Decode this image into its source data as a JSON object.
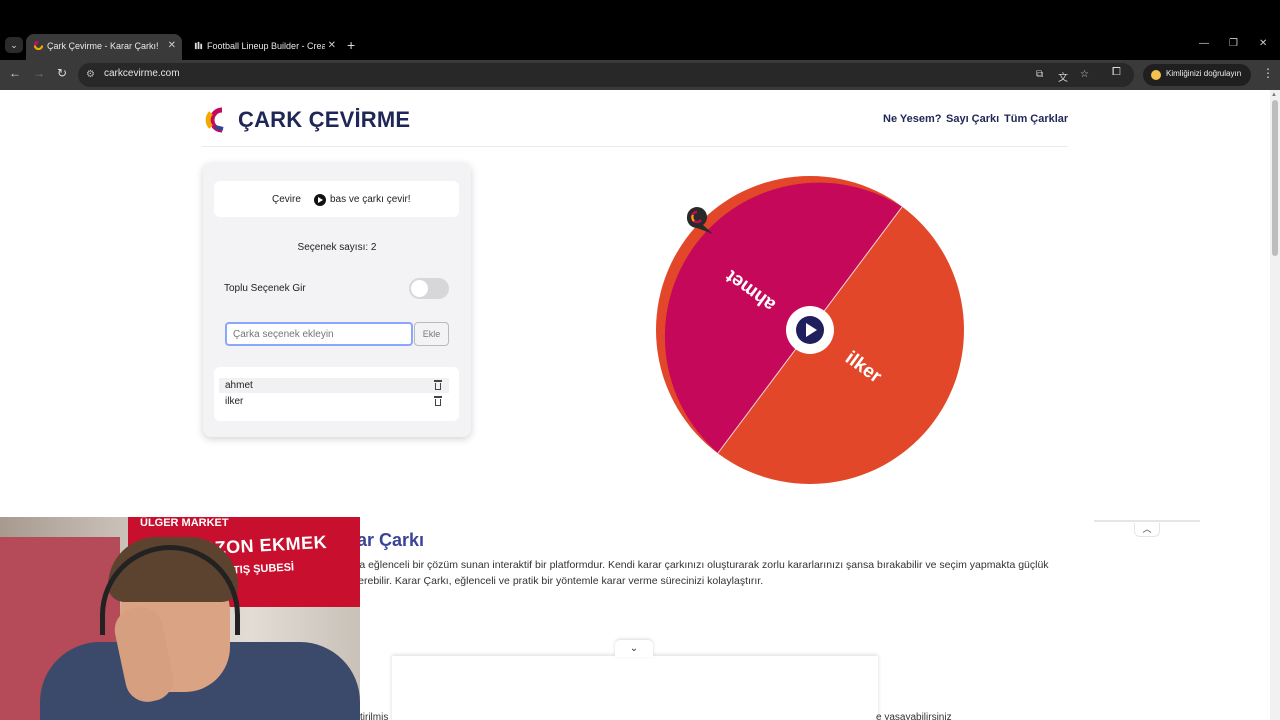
{
  "browser": {
    "tabs": [
      {
        "title": "Çark Çevirme - Karar Çarkı!",
        "active": true
      },
      {
        "title": "Football Lineup Builder - Create",
        "active": false
      }
    ],
    "url": "carkcevirme.com",
    "profile_label": "Kimliğinizi doğrulayın"
  },
  "header": {
    "brand": "ÇARK ÇEVİRME",
    "nav": [
      "Ne Yesem?",
      "Sayı Çarkı",
      "Tüm Çarklar"
    ]
  },
  "panel": {
    "instruction_before": "Çevire",
    "instruction_after": "bas ve çarkı çevir!",
    "option_count": "Seçenek sayısı: 2",
    "bulk_label": "Toplu Seçenek Gir",
    "bulk_enabled": false,
    "input_placeholder": "Çarka seçenek ekleyin",
    "add_button": "Ekle",
    "options": [
      "ahmet",
      "ilker"
    ]
  },
  "wheel": {
    "segments": [
      {
        "label": "ahmet",
        "color": "#c5085a"
      },
      {
        "label": "ilker",
        "color": "#e2472a"
      }
    ],
    "hub_color": "#1f1f5e"
  },
  "content": {
    "section_title": "rar Çarkı",
    "paragraph_line1": "ara eğlenceli bir çözüm sunan interaktif bir platformdur. Kendi karar çarkınızı oluşturarak zorlu kararlarınızı şansa bırakabilir ve seçim yapmakta güçlük",
    "paragraph_line2": "sterebilir. Karar Çarkı, eğlenceli ve pratik bir yöntemle karar verme sürecinizi kolaylaştırır.",
    "bottom_left": "tirilmiş",
    "bottom_right": "e yaşayabilirsiniz"
  },
  "webcam": {
    "sign_top": "ÜLGER MARKET",
    "sign_main": "TARZON EKMEK FIRINI",
    "sign_sub": "TIŞ ŞUBESİ"
  },
  "icons": {
    "play": "play-circle-icon",
    "delete": "trash-icon",
    "back": "arrow-left-icon",
    "forward": "arrow-right-icon",
    "reload": "reload-icon"
  }
}
